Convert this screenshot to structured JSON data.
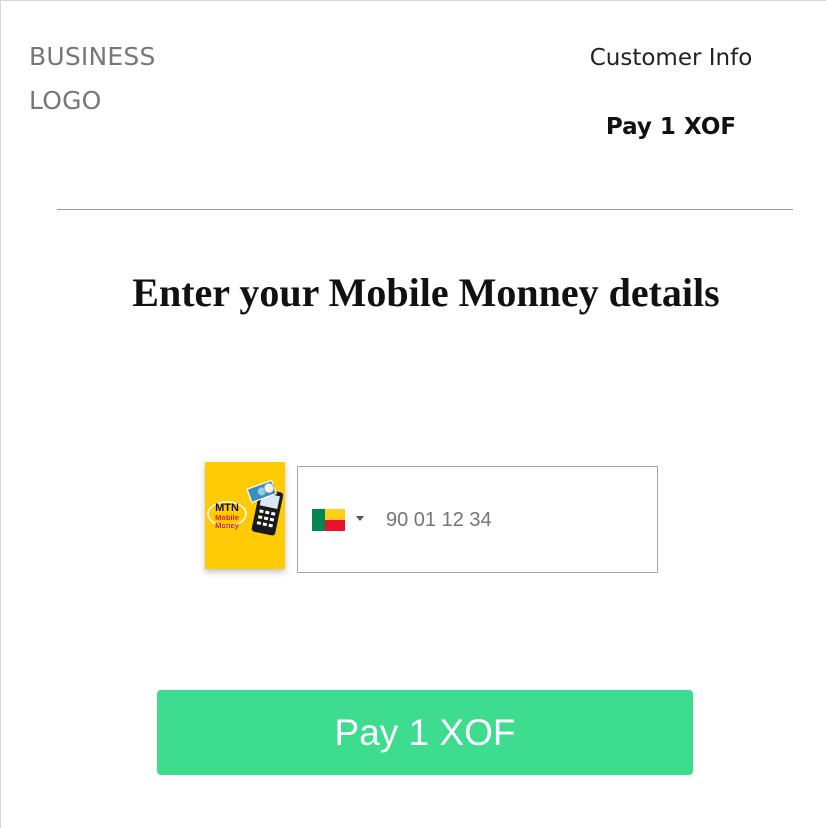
{
  "header": {
    "logo_line1": "BUSINESS",
    "logo_line2": "LOGO",
    "customer_info": "Customer Info",
    "pay_amount": "Pay 1 XOF"
  },
  "main": {
    "heading": "Enter your Mobile Monney details"
  },
  "payment": {
    "provider_logo_text": [
      "MTN",
      "Mobile",
      "Money"
    ],
    "country_flag": "benin-flag-icon",
    "phone_placeholder": "90 01 12 34",
    "phone_value": "",
    "pay_button_label": "Pay 1 XOF"
  },
  "colors": {
    "button": "#3ddc8f",
    "mtn_yellow": "#ffcb05",
    "flag_green": "#008751",
    "flag_yellow": "#fcd116",
    "flag_red": "#e8112d"
  }
}
